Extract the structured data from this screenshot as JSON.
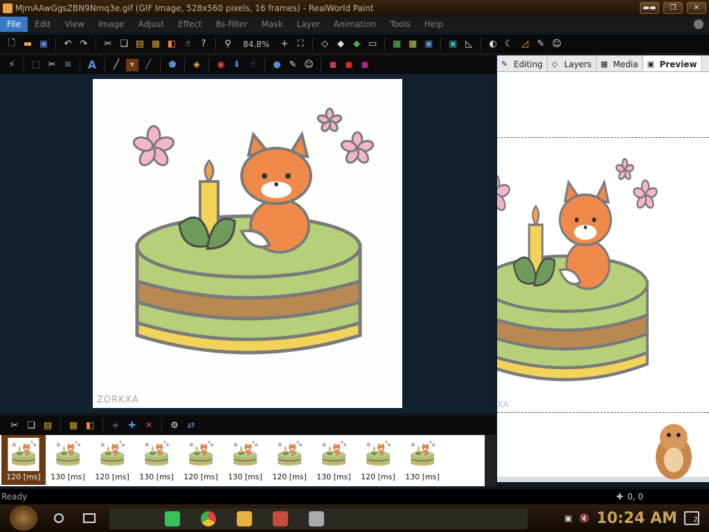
{
  "window": {
    "title": "MjmAAwGgsZBN9Nmq3e.gif (GIF Image, 528x560 pixels, 16 frames) - RealWorld Paint",
    "buttons": [
      "▬▬",
      "❐",
      "✕"
    ]
  },
  "menu": [
    "File",
    "Edit",
    "View",
    "Image",
    "Adjust",
    "Effect",
    "8s-filter",
    "Mask",
    "Layer",
    "Animation",
    "Tools",
    "Help"
  ],
  "toolbar": {
    "zoom": "84.8%"
  },
  "canvas": {
    "watermark": "ZORKXA"
  },
  "right_panel": {
    "tabs": [
      {
        "label": "Editing",
        "icon": "editing-icon"
      },
      {
        "label": "Layers",
        "icon": "layers-icon"
      },
      {
        "label": "Media",
        "icon": "media-icon"
      },
      {
        "label": "Preview",
        "icon": "preview-icon",
        "active": true
      }
    ],
    "preview_watermark": "XA"
  },
  "frames": [
    {
      "label": "120 [ms]",
      "selected": true
    },
    {
      "label": "130 [ms]"
    },
    {
      "label": "120 [ms]"
    },
    {
      "label": "130 [ms]"
    },
    {
      "label": "120 [ms]"
    },
    {
      "label": "130 [ms]"
    },
    {
      "label": "120 [ms]"
    },
    {
      "label": "130 [ms]"
    },
    {
      "label": "120 [ms]"
    },
    {
      "label": "130 [ms]"
    }
  ],
  "status": {
    "text": "Ready",
    "coords": "0, 0"
  },
  "taskbar": {
    "clock": "10:24 AM",
    "notifications": "2"
  },
  "colors": {
    "menu_active": "#3a78c8",
    "frame_selected": "#6a3a14",
    "clock": "#c9a25a"
  }
}
